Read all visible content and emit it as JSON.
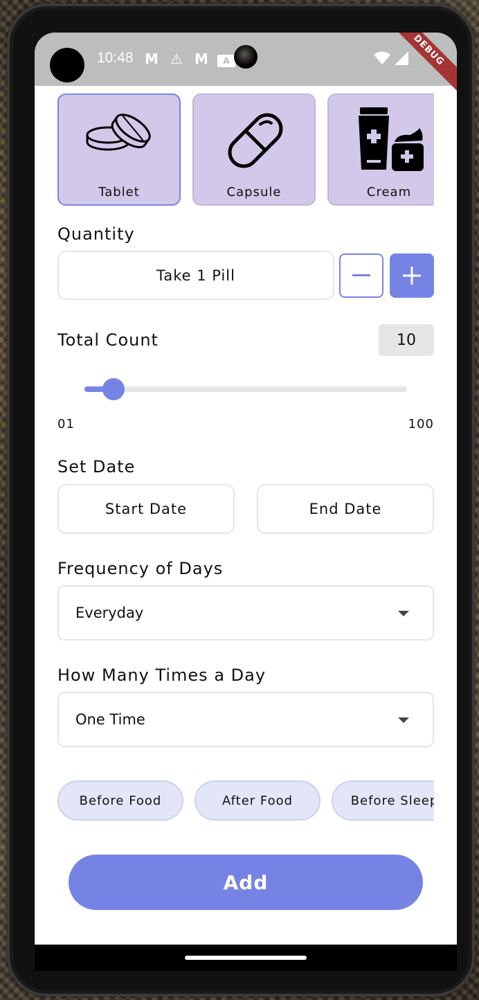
{
  "status_bar": {
    "time": "10:48",
    "notification_icons": [
      "gmail-icon",
      "warning-icon",
      "gmail-icon",
      "app-a-icon"
    ],
    "debug_banner": "DEBUG"
  },
  "form_types": [
    {
      "label": "Tablet",
      "icon": "tablet-icon",
      "selected": true
    },
    {
      "label": "Capsule",
      "icon": "capsule-icon",
      "selected": false
    },
    {
      "label": "Cream",
      "icon": "cream-icon",
      "selected": false
    }
  ],
  "quantity": {
    "title": "Quantity",
    "value": "Take 1 Pill",
    "minus_icon": "minus-icon",
    "plus_icon": "plus-icon"
  },
  "total_count": {
    "title": "Total Count",
    "value": "10",
    "slider_min_label": "01",
    "slider_max_label": "100",
    "slider_min": 1,
    "slider_max": 100,
    "slider_value": 10
  },
  "set_date": {
    "title": "Set Date",
    "start_label": "Start Date",
    "end_label": "End Date"
  },
  "frequency": {
    "title": "Frequency of Days",
    "selected": "Everyday"
  },
  "times_a_day": {
    "title": "How Many Times a Day",
    "selected": "One Time"
  },
  "timing_chips": [
    "Before Food",
    "After Food",
    "Before Sleep"
  ],
  "add_button": "Add",
  "colors": {
    "accent": "#7584e4",
    "card_bg": "#d2c8ea",
    "chip_bg": "#e3e6f8",
    "statusbar": "#bdbdbd"
  }
}
